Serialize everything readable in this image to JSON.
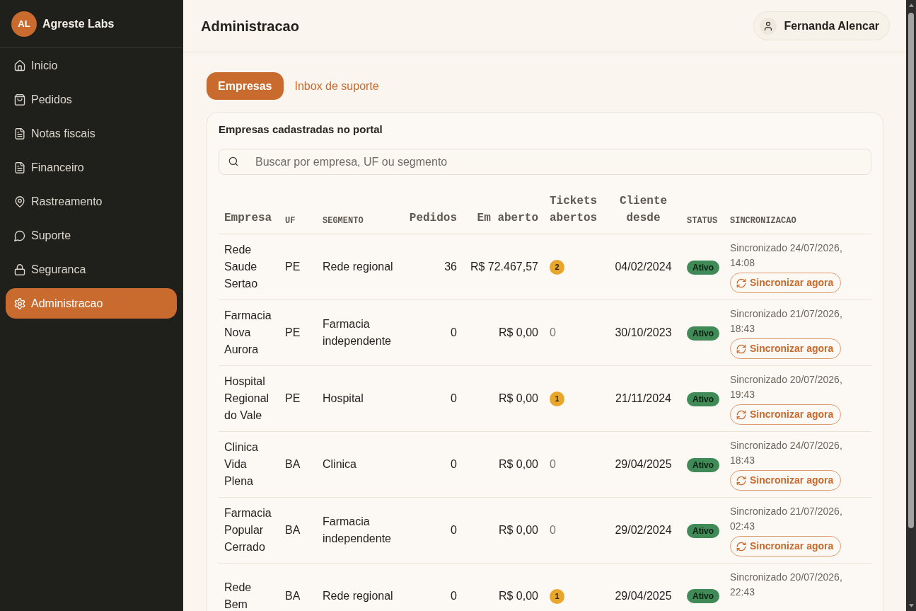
{
  "sidebar": {
    "brand": {
      "initials": "AL",
      "name": "Agreste Labs"
    },
    "items": [
      {
        "label": "Inicio",
        "selected": false
      },
      {
        "label": "Pedidos",
        "selected": false
      },
      {
        "label": "Notas fiscais",
        "selected": false
      },
      {
        "label": "Financeiro",
        "selected": false
      },
      {
        "label": "Rastreamento",
        "selected": false
      },
      {
        "label": "Suporte",
        "selected": false
      },
      {
        "label": "Seguranca",
        "selected": false
      },
      {
        "label": "Administracao",
        "selected": true
      }
    ]
  },
  "header": {
    "title": "Administracao",
    "user": "Fernanda Alencar"
  },
  "tabs": [
    {
      "label": "Empresas",
      "selected": true
    },
    {
      "label": "Inbox de suporte",
      "selected": false
    }
  ],
  "panel": {
    "title": "Empresas cadastradas no portal",
    "search": {
      "placeholder": "Buscar por empresa, UF ou segmento"
    },
    "table": {
      "columns": [
        "Empresa",
        "UF",
        "SEGMENTO",
        "Pedidos",
        "Em aberto",
        "Tickets abertos",
        "Cliente desde",
        "STATUS",
        "SINCRONIZACAO"
      ],
      "rows": [
        {
          "company": "Rede Saude Sertao",
          "uf": "PE",
          "segment": "Rede regional",
          "orders": "36",
          "open_amount": "R$ 72.467,57",
          "tickets": {
            "count": "2",
            "badge": true
          },
          "client_since": "04/02/2024",
          "status": "Ativo",
          "sync": {
            "text": "Sincronizado 24/07/2026, 14:08",
            "button": "Sincronizar agora"
          }
        },
        {
          "company": "Farmacia Nova Aurora",
          "uf": "PE",
          "segment": "Farmacia independente",
          "orders": "0",
          "open_amount": "R$ 0,00",
          "tickets": {
            "count": "0",
            "badge": false
          },
          "client_since": "30/10/2023",
          "status": "Ativo",
          "sync": {
            "text": "Sincronizado 21/07/2026, 18:43",
            "button": "Sincronizar agora"
          }
        },
        {
          "company": "Hospital Regional do Vale",
          "uf": "PE",
          "segment": "Hospital",
          "orders": "0",
          "open_amount": "R$ 0,00",
          "tickets": {
            "count": "1",
            "badge": true
          },
          "client_since": "21/11/2024",
          "status": "Ativo",
          "sync": {
            "text": "Sincronizado 20/07/2026, 19:43",
            "button": "Sincronizar agora"
          }
        },
        {
          "company": "Clinica Vida Plena",
          "uf": "BA",
          "segment": "Clinica",
          "orders": "0",
          "open_amount": "R$ 0,00",
          "tickets": {
            "count": "0",
            "badge": false
          },
          "client_since": "29/04/2025",
          "status": "Ativo",
          "sync": {
            "text": "Sincronizado 24/07/2026, 18:43",
            "button": "Sincronizar agora"
          }
        },
        {
          "company": "Farmacia Popular Cerrado",
          "uf": "BA",
          "segment": "Farmacia independente",
          "orders": "0",
          "open_amount": "R$ 0,00",
          "tickets": {
            "count": "0",
            "badge": false
          },
          "client_since": "29/02/2024",
          "status": "Ativo",
          "sync": {
            "text": "Sincronizado 21/07/2026, 02:43",
            "button": "Sincronizar agora"
          }
        },
        {
          "company": "Rede Bem",
          "uf": "BA",
          "segment": "Rede regional",
          "orders": "0",
          "open_amount": "R$ 0,00",
          "tickets": {
            "count": "1",
            "badge": true
          },
          "client_since": "29/04/2025",
          "status": "Ativo",
          "sync": {
            "text": "Sincronizado 20/07/2026, 22:43"
          }
        }
      ]
    }
  }
}
